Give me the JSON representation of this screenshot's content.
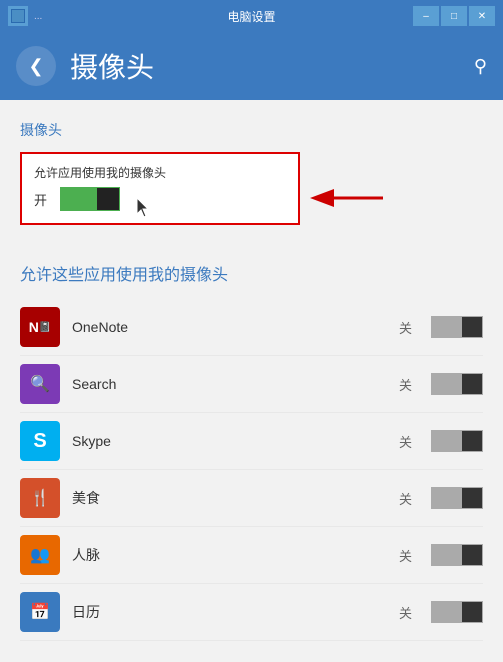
{
  "titlebar": {
    "icon_label": "⊞",
    "dots": "...",
    "title": "电脑设置",
    "minimize_label": "–",
    "restore_label": "□",
    "close_label": "✕"
  },
  "navbar": {
    "back_label": "❮",
    "title": "摄像头",
    "search_icon": "🔍"
  },
  "content": {
    "camera_section_title": "摄像头",
    "camera_toggle_label": "允许应用使用我的摄像头",
    "camera_toggle_on": "开",
    "apps_section_title": "允许这些应用使用我的摄像头",
    "apps": [
      {
        "name": "OneNote",
        "status": "关",
        "icon_bg": "#a70000",
        "icon_text": "N🖊",
        "icon_color": "#8B0000"
      },
      {
        "name": "Search",
        "status": "关",
        "icon_bg": "#7c3ab5",
        "icon_text": "🔍",
        "icon_color": "#7c3ab5"
      },
      {
        "name": "Skype",
        "status": "关",
        "icon_bg": "#00aff0",
        "icon_text": "S",
        "icon_color": "#00aff0"
      },
      {
        "name": "美食",
        "status": "关",
        "icon_bg": "#d4502a",
        "icon_text": "🍴",
        "icon_color": "#d4502a"
      },
      {
        "name": "人脉",
        "status": "关",
        "icon_bg": "#e86800",
        "icon_text": "👥",
        "icon_color": "#e86800"
      },
      {
        "name": "日历",
        "status": "关",
        "icon_bg": "#3a7abf",
        "icon_text": "📅",
        "icon_color": "#3a7abf"
      }
    ]
  }
}
